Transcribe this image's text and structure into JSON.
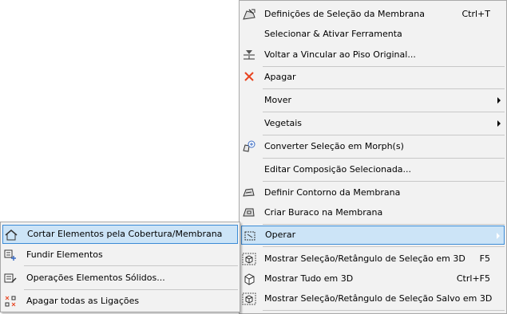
{
  "main_menu": {
    "items": [
      {
        "label": "Definições de Seleção da Membrana",
        "shortcut": "Ctrl+T",
        "icon": "membrane-settings-icon"
      },
      {
        "label": "Selecionar & Ativar Ferramenta",
        "shortcut": "",
        "icon": ""
      },
      {
        "label": "Voltar a Vincular ao Piso Original...",
        "shortcut": "",
        "icon": "relink-floor-icon"
      },
      {
        "label": "Apagar",
        "shortcut": "",
        "icon": "delete-x-icon"
      },
      {
        "label": "Mover",
        "shortcut": "",
        "icon": "",
        "submenu": true
      },
      {
        "label": "Vegetais",
        "shortcut": "",
        "icon": "",
        "submenu": true
      },
      {
        "label": "Converter Seleção em Morph(s)",
        "shortcut": "",
        "icon": "convert-morph-icon"
      },
      {
        "label": "Editar Composição Selecionada...",
        "shortcut": "",
        "icon": ""
      },
      {
        "label": "Definir Contorno da Membrana",
        "shortcut": "",
        "icon": "define-contour-icon"
      },
      {
        "label": "Criar Buraco na Membrana",
        "shortcut": "",
        "icon": "create-hole-icon"
      },
      {
        "label": "Operar",
        "shortcut": "",
        "icon": "operate-icon",
        "submenu": true,
        "highlighted": true
      },
      {
        "label": "Mostrar Seleção/Retângulo de Seleção em 3D",
        "shortcut": "F5",
        "icon": "show-selection-3d-icon"
      },
      {
        "label": "Mostrar Tudo em 3D",
        "shortcut": "Ctrl+F5",
        "icon": "show-all-3d-icon"
      },
      {
        "label": "Mostrar Seleção/Retângulo de Seleção Salvo em 3D",
        "shortcut": "",
        "icon": "show-saved-selection-3d-icon"
      }
    ]
  },
  "sub_menu": {
    "items": [
      {
        "label": "Cortar Elementos pela Cobertura/Membrana",
        "icon": "trim-to-roof-icon",
        "highlighted": true
      },
      {
        "label": "Fundir Elementos",
        "icon": "merge-elements-icon"
      },
      {
        "label": "Operações Elementos Sólidos...",
        "icon": "solid-operations-icon"
      },
      {
        "label": "Apagar todas as Ligações",
        "icon": "delete-connections-icon"
      }
    ]
  },
  "colors": {
    "menu_bg": "#f2f2f2",
    "highlight_bg": "#cce4f7",
    "highlight_border": "#3b8bd6",
    "delete_icon": "#e8431f",
    "separator": "#c8c8c8"
  }
}
